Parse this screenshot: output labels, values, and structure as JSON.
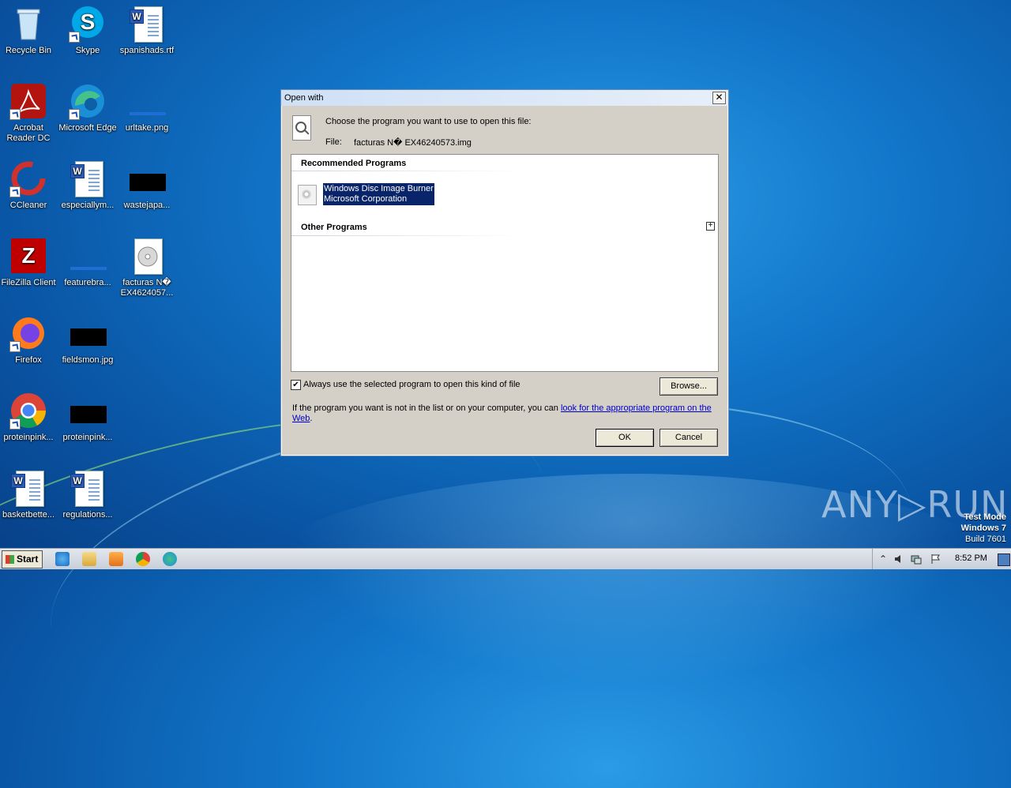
{
  "desktop": {
    "icons": [
      {
        "label": "Recycle Bin"
      },
      {
        "label": "Skype"
      },
      {
        "label": "spanishads.rtf"
      },
      {
        "label": "Acrobat Reader DC"
      },
      {
        "label": "Microsoft Edge"
      },
      {
        "label": "urltake.png"
      },
      {
        "label": "CCleaner"
      },
      {
        "label": "especiallym..."
      },
      {
        "label": "wastejapa..."
      },
      {
        "label": "FileZilla Client"
      },
      {
        "label": "featurebra..."
      },
      {
        "label": "facturas N� EX4624057..."
      },
      {
        "label": "Firefox"
      },
      {
        "label": "fieldsmon.jpg"
      },
      {
        "label": "Google Chrome"
      },
      {
        "label": "proteinpink..."
      },
      {
        "label": "basketbette..."
      },
      {
        "label": "regulations..."
      }
    ]
  },
  "dialog": {
    "title": "Open with",
    "close_glyph": "✕",
    "instruction": "Choose the program you want to use to open this file:",
    "file_label": "File:",
    "file_name": "facturas N� EX46240573.img",
    "recommended_header": "Recommended Programs",
    "recommended_programs": [
      {
        "name": "Windows Disc Image Burner",
        "publisher": "Microsoft Corporation"
      }
    ],
    "other_header": "Other Programs",
    "expand_glyph": "+",
    "always_use_label": "Always use the selected program to open this kind of file",
    "always_use_checked": true,
    "check_glyph": "✔",
    "browse_label": "Browse...",
    "info_text": "If the program you want is not in the list or on your computer, you can ",
    "info_link": "look for the appropriate program on the Web",
    "info_end": ".",
    "ok_label": "OK",
    "cancel_label": "Cancel"
  },
  "watermark": {
    "brand": "ANY▷RUN",
    "mode": "Test Mode",
    "os": "Windows 7",
    "build": "Build 7601"
  },
  "taskbar": {
    "start_label": "Start",
    "clock": "8:52 PM",
    "tray_up_glyph": "⌃"
  }
}
